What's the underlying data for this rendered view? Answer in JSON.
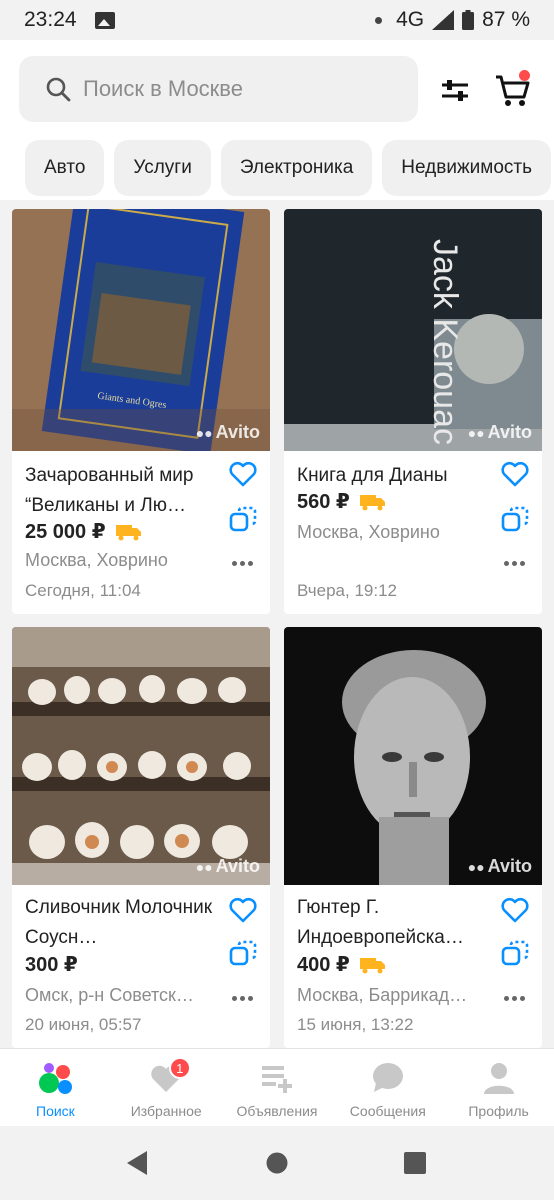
{
  "status_bar": {
    "time": "23:24",
    "network": "4G",
    "battery": "87 %"
  },
  "search": {
    "placeholder": "Поиск в Москве",
    "icon": "search-icon"
  },
  "categories": [
    "Авто",
    "Услуги",
    "Электроника",
    "Недвижимость"
  ],
  "listings": [
    {
      "title": "Зачарованный мир “Великаны и Лю…",
      "price": "25 000 ₽",
      "delivery": true,
      "location": "Москва, Ховрино",
      "date": "Сегодня, 11:04",
      "watermark": "Avito",
      "book_text": "Giants and Ogres"
    },
    {
      "title": "Книга для Дианы",
      "price": "560 ₽",
      "delivery": true,
      "location": "Москва, Ховрино",
      "date": "Вчера, 19:12",
      "watermark": "Avito",
      "book_text": "Jack Kerouac The Dharma Bums"
    },
    {
      "title": "Сливочник Молочник Соусн…",
      "price": "300 ₽",
      "delivery": false,
      "location": "Омск, р-н Советск…",
      "date": "20 июня, 05:57",
      "watermark": "Avito"
    },
    {
      "title": "Гюнтер Г. Индоевропейска…",
      "price": "400 ₽",
      "delivery": true,
      "location": "Москва, Баррикад…",
      "date": "15 июня, 13:22",
      "watermark": "Avito"
    }
  ],
  "bottom_nav": [
    {
      "label": "Поиск",
      "icon": "search-bubbles-icon",
      "active": true
    },
    {
      "label": "Избранное",
      "icon": "heart-icon",
      "badge": "1"
    },
    {
      "label": "Объявления",
      "icon": "listings-add-icon"
    },
    {
      "label": "Сообщения",
      "icon": "chat-icon"
    },
    {
      "label": "Профиль",
      "icon": "profile-icon"
    }
  ],
  "colors": {
    "accent": "#0a8fff",
    "badge": "#ff4b4b",
    "delivery": "#ffb41f"
  }
}
